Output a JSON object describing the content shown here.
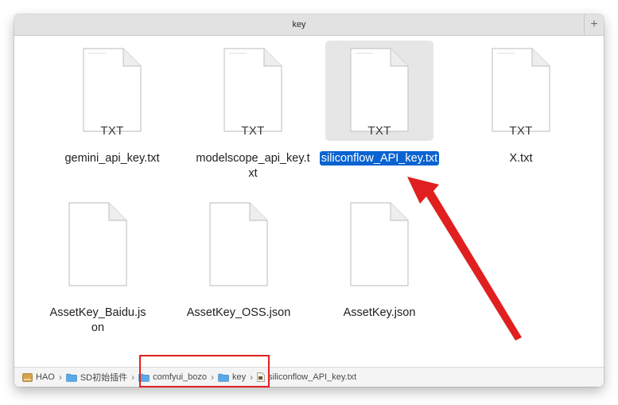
{
  "window": {
    "title": "key",
    "new_tab_symbol": "+"
  },
  "files": [
    {
      "name": "gemini_api_key.txt",
      "badge": "TXT",
      "selected": false
    },
    {
      "name": "modelscope_api_key.txt",
      "badge": "TXT",
      "selected": false
    },
    {
      "name": "siliconflow_API_key.txt",
      "badge": "TXT",
      "selected": true
    },
    {
      "name": "X.txt",
      "badge": "TXT",
      "selected": false
    },
    {
      "name": "AssetKey_Baidu.json",
      "badge": "",
      "selected": false
    },
    {
      "name": "AssetKey_OSS.json",
      "badge": "",
      "selected": false
    },
    {
      "name": "AssetKey.json",
      "badge": "",
      "selected": false
    }
  ],
  "pathbar": {
    "items": [
      {
        "label": "HAO",
        "icon": "home-drive-icon"
      },
      {
        "label": "SD初始插件",
        "icon": "folder-icon"
      },
      {
        "label": "comfyui_bozo",
        "icon": "folder-icon"
      },
      {
        "label": "key",
        "icon": "folder-icon"
      },
      {
        "label": "siliconflow_API_key.txt",
        "icon": "text-file-icon"
      }
    ],
    "separator": "›"
  },
  "annotations": {
    "color": "#e02020"
  },
  "colors": {
    "selection": "#0a63d1",
    "folder": "#5aa9e6"
  }
}
